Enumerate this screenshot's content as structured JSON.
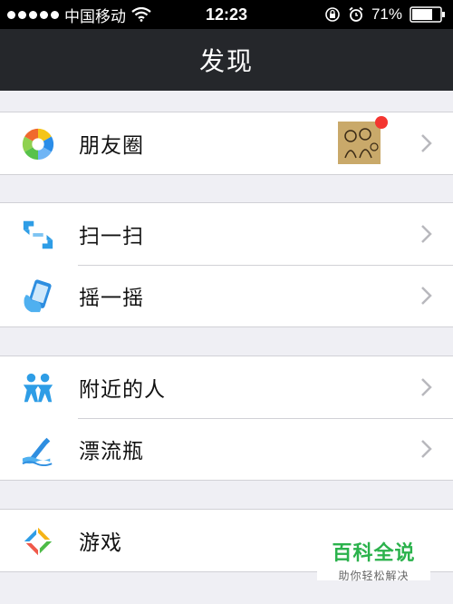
{
  "status_bar": {
    "carrier": "中国移动",
    "time": "12:23",
    "battery": "71%",
    "icons": [
      "signal-icon",
      "wifi-icon",
      "rotation-lock-icon",
      "alarm-icon",
      "battery-icon"
    ]
  },
  "nav": {
    "title": "发现"
  },
  "groups": [
    {
      "items": [
        {
          "label": "朋友圈",
          "icon": "moments-icon",
          "has_thumbnail": true,
          "has_red_dot": true
        }
      ]
    },
    {
      "items": [
        {
          "label": "扫一扫",
          "icon": "scan-icon"
        },
        {
          "label": "摇一摇",
          "icon": "shake-icon"
        }
      ]
    },
    {
      "items": [
        {
          "label": "附近的人",
          "icon": "people-nearby-icon"
        },
        {
          "label": "漂流瓶",
          "icon": "drift-bottle-icon"
        }
      ]
    },
    {
      "items": [
        {
          "label": "游戏",
          "icon": "games-icon"
        }
      ]
    }
  ],
  "watermark": {
    "title": "百科全说",
    "subtitle": "助你轻松解决"
  },
  "colors": {
    "nav_bg": "#25272b",
    "page_bg": "#efeff4",
    "red_dot": "#f43530",
    "watermark_green": "#2bb24c"
  }
}
